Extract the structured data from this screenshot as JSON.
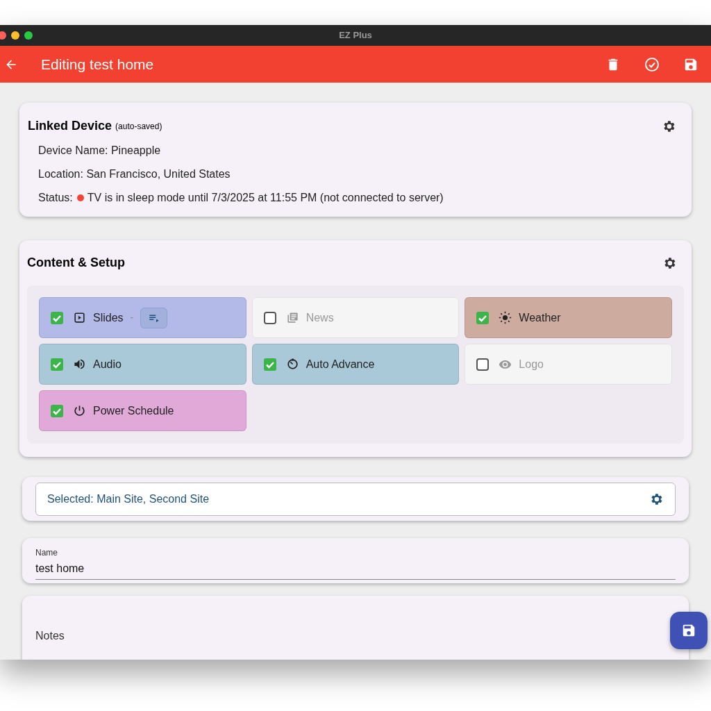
{
  "window": {
    "title": "EZ Plus"
  },
  "app_bar": {
    "title": "Editing test home"
  },
  "linked_device": {
    "title": "Linked Device",
    "note": "(auto-saved)",
    "lines": [
      "Device Name: Pineapple",
      "Location: San Francisco, United States"
    ],
    "status_label": "Status:",
    "status_text": "TV is in sleep mode until 7/3/2025 at 11:55 PM (not connected to server)"
  },
  "content_setup": {
    "title": "Content & Setup",
    "tiles": [
      {
        "label": "Slides",
        "checked": true,
        "color": "#b3bae8",
        "separator": "-"
      },
      {
        "label": "News",
        "checked": false,
        "color": "#f5f5f5"
      },
      {
        "label": "Weather",
        "checked": true,
        "color": "#ceab9f"
      },
      {
        "label": "Audio",
        "checked": true,
        "color": "#a9c8d8"
      },
      {
        "label": "Auto Advance",
        "checked": true,
        "color": "#a9c8d8"
      },
      {
        "label": "Logo",
        "checked": false,
        "color": "#f5f5f5"
      },
      {
        "label": "Power Schedule",
        "checked": true,
        "color": "#e0a9d8"
      }
    ]
  },
  "sites": {
    "value": "Selected: Main Site, Second Site"
  },
  "name_field": {
    "label": "Name",
    "value": "test home"
  },
  "notes_field": {
    "label": "Notes"
  }
}
